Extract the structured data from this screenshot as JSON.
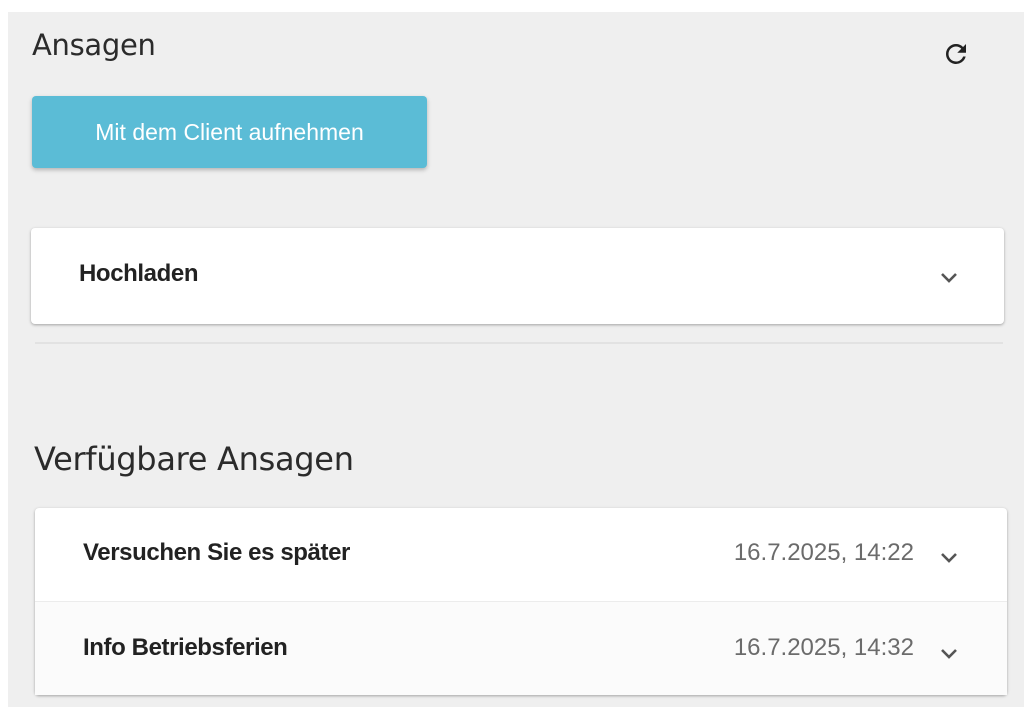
{
  "header": {
    "title": "Ansagen",
    "refresh_icon": "refresh-icon"
  },
  "actions": {
    "record_button_label": "Mit dem Client aufnehmen"
  },
  "upload": {
    "label": "Hochladen",
    "expand_icon": "chevron-down-icon"
  },
  "available": {
    "title": "Verfügbare Ansagen",
    "items": [
      {
        "name": "Versuchen Sie es später",
        "date": "16.7.2025, 14:22"
      },
      {
        "name": "Info Betriebsferien",
        "date": "16.7.2025, 14:32"
      }
    ]
  },
  "colors": {
    "panel_bg": "#efefef",
    "primary_button": "#5bbcd6",
    "card_bg": "#ffffff"
  }
}
